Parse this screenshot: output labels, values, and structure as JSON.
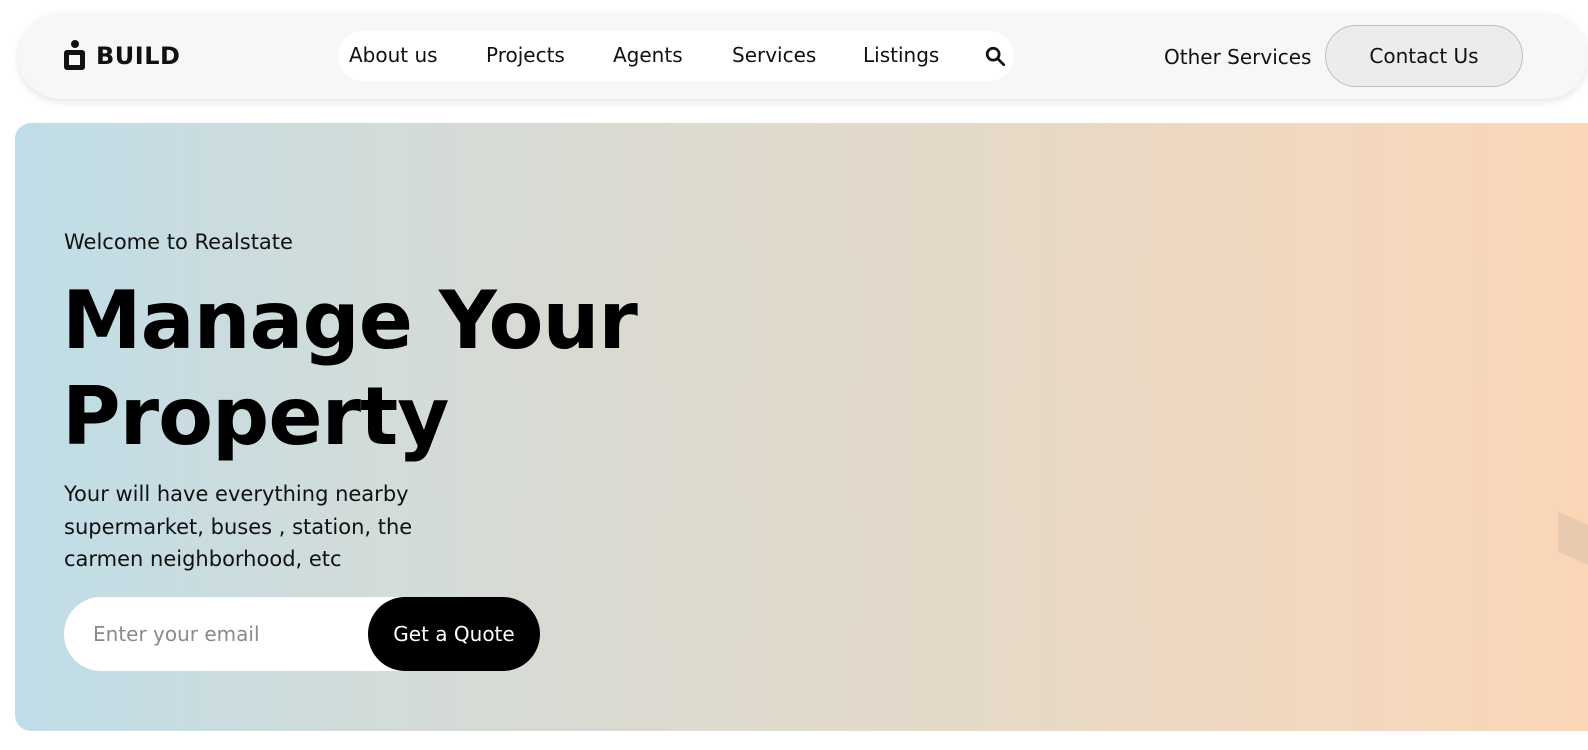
{
  "brand": {
    "name": "BUILD",
    "icon": "building-logo-icon"
  },
  "nav": {
    "links": [
      {
        "label": "About us"
      },
      {
        "label": "Projects"
      },
      {
        "label": "Agents"
      },
      {
        "label": "Services"
      },
      {
        "label": "Listings"
      }
    ],
    "search_icon": "search-icon",
    "other_services": "Other Services",
    "contact": "Contact Us"
  },
  "hero": {
    "welcome": "Welcome to Realstate",
    "headline_line1": "Manage Your",
    "headline_line2": "Property",
    "description": "Your will have everything nearby supermarket, buses , station, the carmen neighborhood, etc",
    "email_placeholder": "Enter your email",
    "email_value": "",
    "cta": "Get a Quote"
  },
  "colors": {
    "gradient_start": "#bfdde8",
    "gradient_end": "#fad6b7",
    "cta_background": "#000000",
    "navbar_background": "#f7f7f7"
  }
}
